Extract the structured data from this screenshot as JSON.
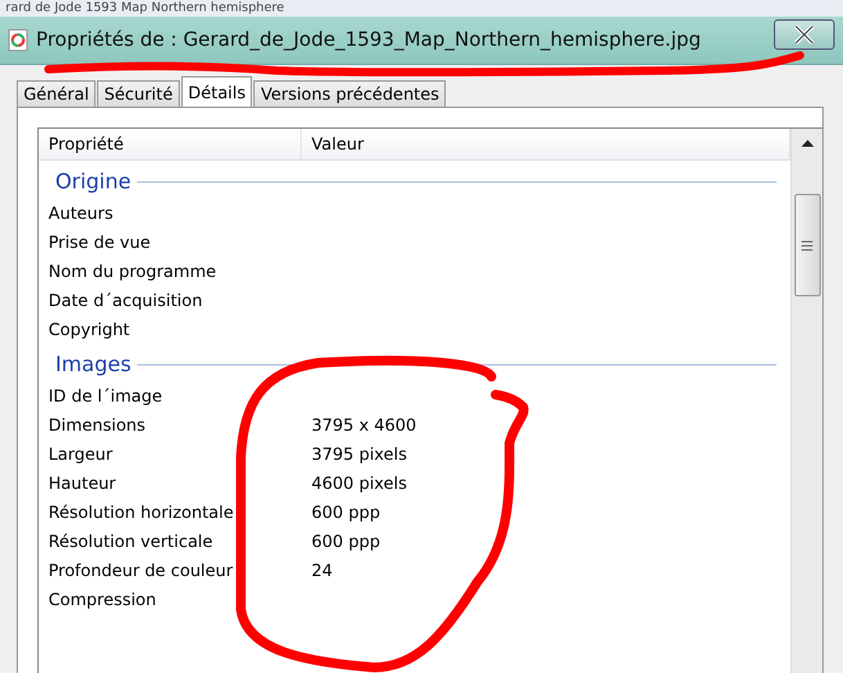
{
  "background_window": {
    "title": "rard de Jode 1593 Map Northern hemisphere"
  },
  "window": {
    "title": "Propriétés de : Gerard_de_Jode_1593_Map_Northern_hemisphere.jpg"
  },
  "tabs": [
    {
      "label": "Général",
      "selected": false
    },
    {
      "label": "Sécurité",
      "selected": false
    },
    {
      "label": "Détails",
      "selected": true
    },
    {
      "label": "Versions précédentes",
      "selected": false
    }
  ],
  "table": {
    "columns": [
      "Propriété",
      "Valeur"
    ],
    "groups": [
      {
        "title": "Origine",
        "rows": [
          {
            "property": "Auteurs"
          },
          {
            "property": "Prise de vue"
          },
          {
            "property": "Nom du programme"
          },
          {
            "property": "Date d´acquisition"
          },
          {
            "property": "Copyright"
          }
        ]
      },
      {
        "title": "Images",
        "rows": [
          {
            "property": "ID de l´image"
          },
          {
            "property": "Dimensions",
            "value": "3795 x 4600"
          },
          {
            "property": "Largeur",
            "value": "3795 pixels"
          },
          {
            "property": "Hauteur",
            "value": "4600 pixels"
          },
          {
            "property": "Résolution horizontale",
            "value": "600 ppp"
          },
          {
            "property": "Résolution verticale",
            "value": "600 ppp"
          },
          {
            "property": "Profondeur de couleur",
            "value": "24"
          },
          {
            "property": "Compression"
          }
        ]
      }
    ]
  }
}
